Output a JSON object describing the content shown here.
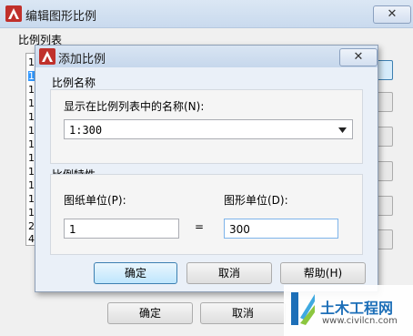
{
  "outer_dialog": {
    "title": "编辑图形比例",
    "close_label": "✕",
    "list_group_label": "比例列表",
    "list_items": [
      "1",
      "1",
      "1",
      "1",
      "1",
      "1",
      "1",
      "1",
      "1",
      "1",
      "1",
      "1",
      "2",
      "4"
    ],
    "buttons": {
      "ok": "确定",
      "cancel": "取消"
    }
  },
  "add_dialog": {
    "title": "添加比例",
    "close_label": "✕",
    "name_group": {
      "label": "比例名称",
      "field_label": "显示在比例列表中的名称(N):",
      "value": "1:300"
    },
    "props_group": {
      "label": "比例特性",
      "paper_units_label": "图纸单位(P):",
      "paper_units_value": "1",
      "equals": "=",
      "drawing_units_label": "图形单位(D):",
      "drawing_units_value": "300"
    },
    "buttons": {
      "ok": "确定",
      "cancel": "取消",
      "help": "帮助(H)"
    }
  },
  "watermark": {
    "name": "土木工程网",
    "url": "www.civilcn.com"
  },
  "colors": {
    "app_icon": "#c0302b",
    "title_bar": "#c9daee",
    "default_button": "#bee6fd",
    "watermark_blue": "#1d6fb8"
  }
}
